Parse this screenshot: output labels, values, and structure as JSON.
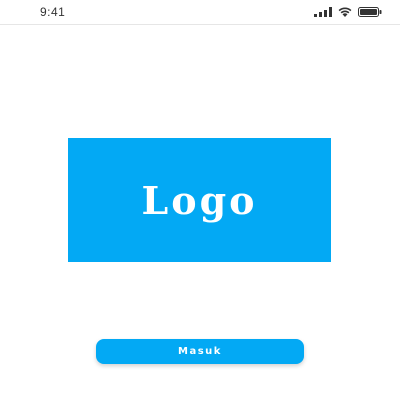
{
  "status_bar": {
    "time": "9:41",
    "icons": [
      "signal-icon",
      "wifi-icon",
      "battery-icon"
    ]
  },
  "logo": {
    "text": "Logo",
    "background_color": "#03a9f4",
    "text_color": "#ffffff"
  },
  "login_button": {
    "label": "Masuk",
    "background_color": "#03a9f4"
  }
}
